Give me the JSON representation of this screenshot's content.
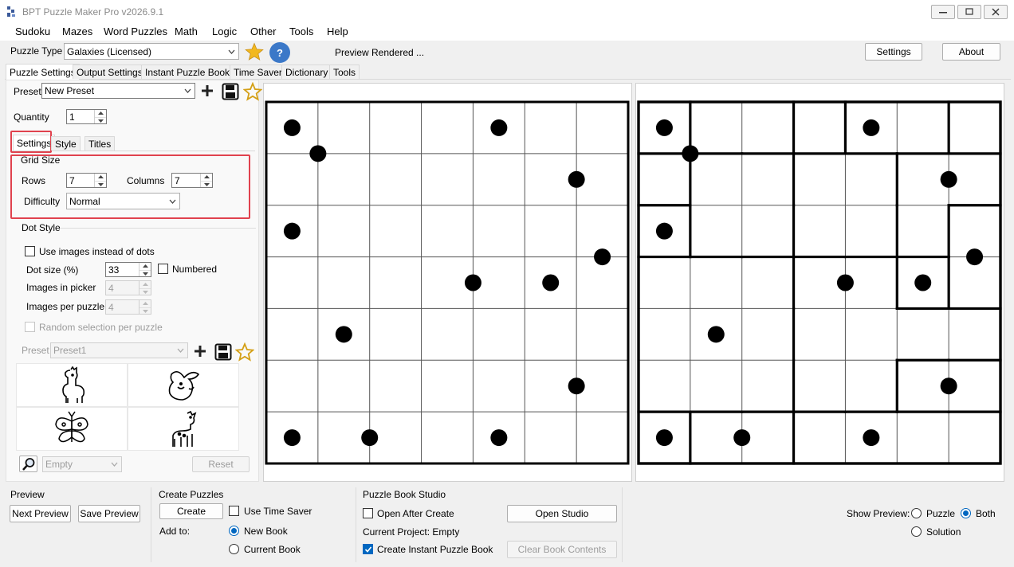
{
  "window": {
    "title": "BPT Puzzle Maker Pro v2026.9.1"
  },
  "menu": [
    "Sudoku",
    "Mazes",
    "Word Puzzles",
    "Math",
    "Logic",
    "Other",
    "Tools",
    "Help"
  ],
  "toolbar": {
    "puzzle_type_label": "Puzzle Type",
    "puzzle_type_value": "Galaxies (Licensed)",
    "status": "Preview Rendered ...",
    "settings_button": "Settings",
    "about_button": "About",
    "help_glyph": "?"
  },
  "main_tabs": [
    "Puzzle Settings",
    "Output Settings",
    "Instant Puzzle Books",
    "Time Saver",
    "Dictionary",
    "Tools"
  ],
  "left": {
    "preset_label": "Preset",
    "preset_value": "New Preset",
    "quantity_label": "Quantity",
    "quantity_value": "1",
    "sub_tabs": [
      "Settings",
      "Style",
      "Titles"
    ],
    "grid_size": {
      "title": "Grid Size",
      "rows_label": "Rows",
      "rows_value": "7",
      "columns_label": "Columns",
      "columns_value": "7",
      "difficulty_label": "Difficulty",
      "difficulty_value": "Normal"
    },
    "dot_style": {
      "title": "Dot Style",
      "use_images_label": "Use images instead of dots",
      "dot_size_label": "Dot size (%)",
      "dot_size_value": "33",
      "numbered_label": "Numbered",
      "images_in_picker_label": "Images in picker",
      "images_in_picker_value": "4",
      "images_per_puzzle_label": "Images per puzzle",
      "images_per_puzzle_value": "4",
      "random_selection_label": "Random selection per puzzle",
      "preset_label": "Preset",
      "preset_value": "Preset1",
      "empty_value": "Empty",
      "reset_button": "Reset"
    }
  },
  "puzzle": {
    "size": 7,
    "dots": [
      [
        0.5,
        0.5
      ],
      [
        0.5,
        4.5
      ],
      [
        1,
        1
      ],
      [
        1.5,
        6
      ],
      [
        2.5,
        0.5
      ],
      [
        3,
        6.5
      ],
      [
        3.5,
        4
      ],
      [
        3.5,
        5.5
      ],
      [
        4.5,
        1.5
      ],
      [
        5.5,
        6
      ],
      [
        6.5,
        0.5
      ],
      [
        6.5,
        2
      ],
      [
        6.5,
        4.5
      ]
    ]
  },
  "solution": {
    "regions": [
      [
        0,
        1,
        1,
        2,
        3,
        3,
        4
      ],
      [
        5,
        6,
        6,
        7,
        7,
        8,
        8
      ],
      [
        9,
        6,
        6,
        7,
        7,
        8,
        10
      ],
      [
        11,
        11,
        11,
        12,
        12,
        13,
        10
      ],
      [
        11,
        11,
        11,
        12,
        12,
        12,
        12
      ],
      [
        11,
        11,
        11,
        12,
        12,
        14,
        14
      ],
      [
        15,
        16,
        16,
        17,
        17,
        17,
        17
      ]
    ]
  },
  "bottom": {
    "preview": {
      "title": "Preview",
      "next_button": "Next Preview",
      "save_button": "Save Preview"
    },
    "create": {
      "title": "Create Puzzles",
      "create_button": "Create",
      "use_time_saver_label": "Use Time Saver",
      "add_to_label": "Add to:",
      "new_book_label": "New Book",
      "current_book_label": "Current Book"
    },
    "studio": {
      "title": "Puzzle Book Studio",
      "open_after_create_label": "Open After Create",
      "open_studio_button": "Open Studio",
      "current_project": "Current Project: Empty",
      "create_instant_label": "Create Instant Puzzle Book",
      "clear_button": "Clear Book Contents"
    },
    "show_preview": {
      "label": "Show Preview:",
      "puzzle": "Puzzle",
      "both": "Both",
      "solution": "Solution"
    }
  },
  "colors": {
    "accent": "#0067c0",
    "highlight": "#e0424e",
    "star": "#f2b81d",
    "help": "#3b78c8"
  }
}
